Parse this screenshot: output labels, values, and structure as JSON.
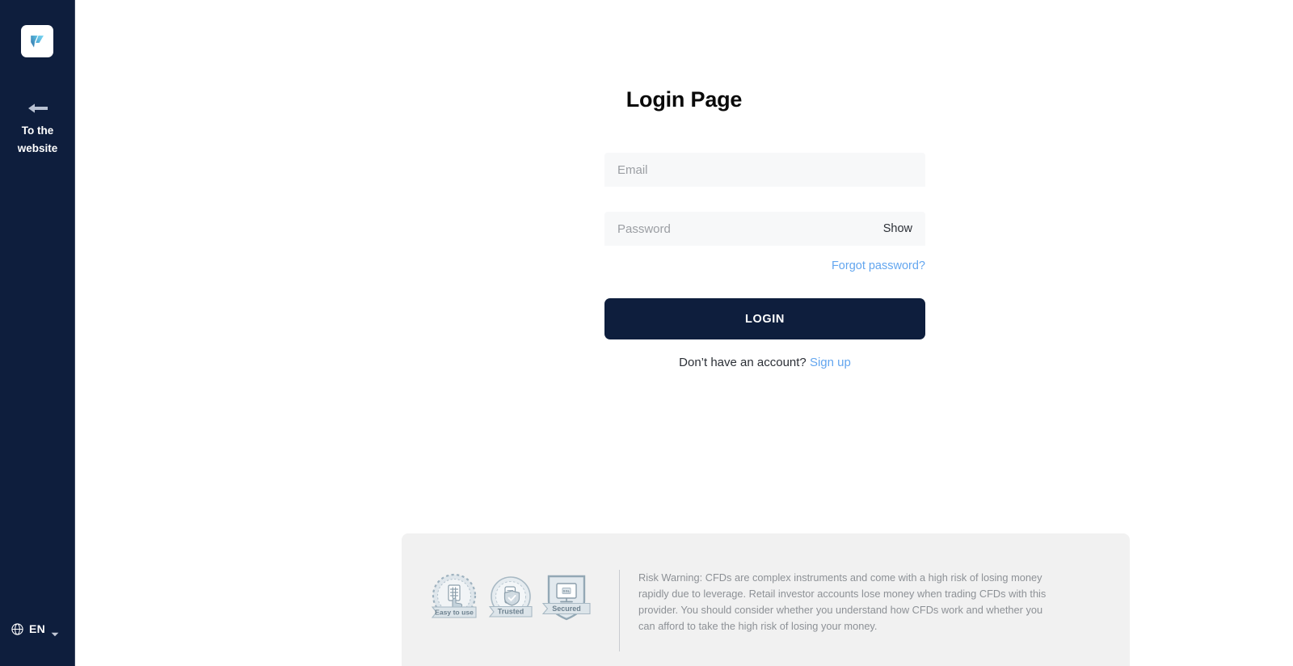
{
  "sidebar": {
    "logo": {
      "icon": "brand-logo-icon",
      "alt": "Brand logo"
    },
    "back_link": {
      "icon": "arrow-left-icon",
      "label": "To the website"
    },
    "language": {
      "icon": "globe-icon",
      "code": "EN",
      "caret": "chevron-down-icon"
    }
  },
  "main": {
    "title": "Login Page",
    "email": {
      "placeholder": "Email",
      "value": ""
    },
    "password": {
      "placeholder": "Password",
      "value": "",
      "show_label": "Show"
    },
    "forgot_password_label": "Forgot password?",
    "login_button_label": "LOGIN",
    "signup_prompt": "Don’t have an account?",
    "signup_link_label": "Sign up"
  },
  "footer": {
    "badges": [
      {
        "name": "easy-to-use-badge",
        "label": "Easy to use"
      },
      {
        "name": "trusted-badge",
        "label": "Trusted"
      },
      {
        "name": "secured-badge",
        "label": "Secured",
        "screen_text": "SSL"
      }
    ],
    "risk_warning": "Risk Warning: CFDs are complex instruments and come with a high risk of losing money rapidly due to leverage. Retail investor accounts lose money when trading CFDs with this provider. You should consider whether you understand how CFDs work and whether you can afford to take the high risk of losing your money."
  },
  "colors": {
    "navy": "#0e1e3d",
    "accent_blue": "#63a6ef",
    "field_bg": "#f7f8f9",
    "footer_bg": "#f1f1f1",
    "badge_gray": "#9fb2bf",
    "muted_text": "#8d9196"
  }
}
